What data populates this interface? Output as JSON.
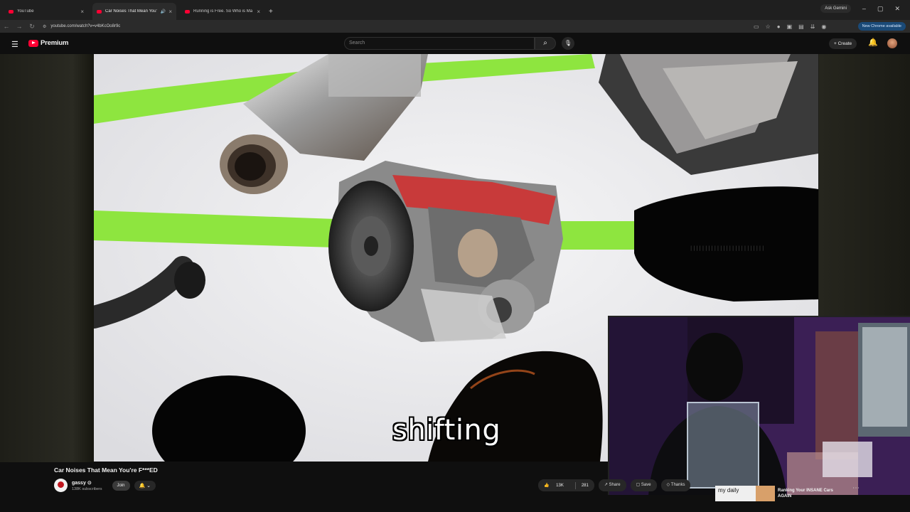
{
  "browser": {
    "tabs": [
      {
        "title": "YouTube",
        "active": false
      },
      {
        "title": "Car Noises That Mean You'",
        "active": true
      },
      {
        "title": "Running is Free. So Who is Ma",
        "active": false
      }
    ],
    "ask_gemini": "Ask Gemini",
    "url": "youtube.com/watch?v=v4bKcOo8r9c",
    "new_chrome": "New Chrome available"
  },
  "masthead": {
    "logo_text": "Premium",
    "search_placeholder": "Search",
    "create_label": "Create"
  },
  "video": {
    "subtitle": "shifting",
    "accent_color": "#8ee53f"
  },
  "details": {
    "title": "Car Noises That Mean You're F***ED",
    "channel_name": "gassy",
    "channel_verified": "⊙",
    "subscribers": "138K subscribers",
    "join_label": "Join",
    "likes": "13K",
    "dislikes": "281",
    "share_label": "Share",
    "save_label": "Save",
    "thanks_label": "Thanks"
  },
  "recommendation": {
    "thumb_text": "my daily",
    "title": "Ranking Your INSANE Cars AGAIN"
  }
}
